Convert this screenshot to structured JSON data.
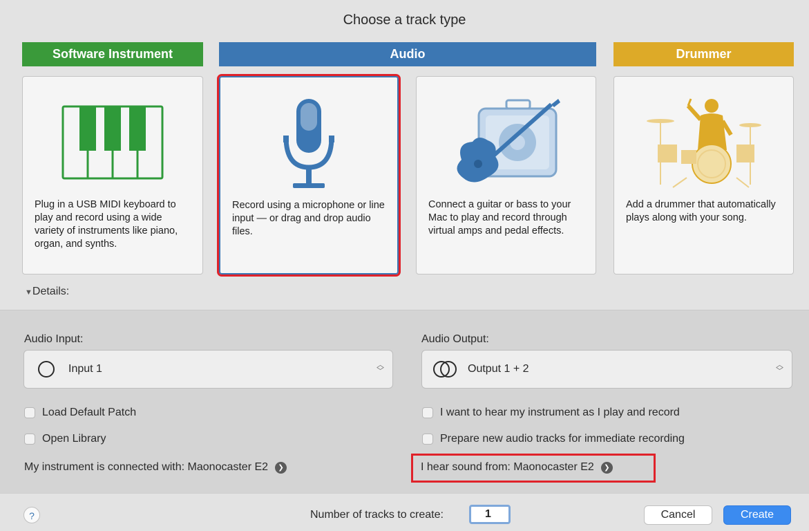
{
  "dialog": {
    "title": "Choose a track type"
  },
  "categories": {
    "software": "Software Instrument",
    "audio": "Audio",
    "drummer": "Drummer"
  },
  "cards": [
    {
      "desc": "Plug in a USB MIDI keyboard to play and record using a wide variety of instruments like piano, organ, and synths.",
      "icon": "piano-keys-icon",
      "color": "#2f9a3a",
      "selected": false
    },
    {
      "desc": "Record using a microphone or line input — or drag and drop audio files.",
      "icon": "microphone-icon",
      "color": "#3c77b3",
      "selected": true
    },
    {
      "desc": "Connect a guitar or bass to your Mac to play and record through virtual amps and pedal effects.",
      "icon": "guitar-amp-icon",
      "color": "#3c77b3",
      "selected": false
    },
    {
      "desc": "Add a drummer that automatically plays along with your song.",
      "icon": "drummer-icon",
      "color": "#ddaa28",
      "selected": false
    }
  ],
  "details": {
    "label": "Details:"
  },
  "input": {
    "label": "Audio Input:",
    "value": "Input 1",
    "load_default_patch": "Load Default Patch",
    "open_library": "Open Library",
    "connected_text": "My instrument is connected with: Maonocaster E2"
  },
  "output": {
    "label": "Audio Output:",
    "value": "Output 1 + 2",
    "hear_instrument": "I want to hear my instrument as I play and record",
    "prepare_tracks": "Prepare new audio tracks for immediate recording",
    "hear_from_text": "I hear sound from: Maonocaster E2"
  },
  "footer": {
    "help": "?",
    "ntracks_label": "Number of tracks to create:",
    "ntracks_value": "1",
    "cancel": "Cancel",
    "create": "Create"
  },
  "colors": {
    "accent_red": "#e0222a",
    "blue": "#3c77b3",
    "green": "#3a9a3a",
    "yellow": "#ddaa28"
  }
}
